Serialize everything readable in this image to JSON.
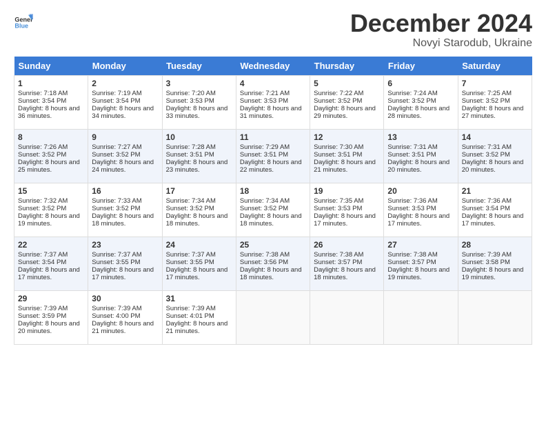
{
  "header": {
    "logo_general": "General",
    "logo_blue": "Blue",
    "month_title": "December 2024",
    "location": "Novyi Starodub, Ukraine"
  },
  "days_of_week": [
    "Sunday",
    "Monday",
    "Tuesday",
    "Wednesday",
    "Thursday",
    "Friday",
    "Saturday"
  ],
  "weeks": [
    [
      {
        "day": "1",
        "sunrise": "Sunrise: 7:18 AM",
        "sunset": "Sunset: 3:54 PM",
        "daylight": "Daylight: 8 hours and 36 minutes."
      },
      {
        "day": "2",
        "sunrise": "Sunrise: 7:19 AM",
        "sunset": "Sunset: 3:54 PM",
        "daylight": "Daylight: 8 hours and 34 minutes."
      },
      {
        "day": "3",
        "sunrise": "Sunrise: 7:20 AM",
        "sunset": "Sunset: 3:53 PM",
        "daylight": "Daylight: 8 hours and 33 minutes."
      },
      {
        "day": "4",
        "sunrise": "Sunrise: 7:21 AM",
        "sunset": "Sunset: 3:53 PM",
        "daylight": "Daylight: 8 hours and 31 minutes."
      },
      {
        "day": "5",
        "sunrise": "Sunrise: 7:22 AM",
        "sunset": "Sunset: 3:52 PM",
        "daylight": "Daylight: 8 hours and 29 minutes."
      },
      {
        "day": "6",
        "sunrise": "Sunrise: 7:24 AM",
        "sunset": "Sunset: 3:52 PM",
        "daylight": "Daylight: 8 hours and 28 minutes."
      },
      {
        "day": "7",
        "sunrise": "Sunrise: 7:25 AM",
        "sunset": "Sunset: 3:52 PM",
        "daylight": "Daylight: 8 hours and 27 minutes."
      }
    ],
    [
      {
        "day": "8",
        "sunrise": "Sunrise: 7:26 AM",
        "sunset": "Sunset: 3:52 PM",
        "daylight": "Daylight: 8 hours and 25 minutes."
      },
      {
        "day": "9",
        "sunrise": "Sunrise: 7:27 AM",
        "sunset": "Sunset: 3:52 PM",
        "daylight": "Daylight: 8 hours and 24 minutes."
      },
      {
        "day": "10",
        "sunrise": "Sunrise: 7:28 AM",
        "sunset": "Sunset: 3:51 PM",
        "daylight": "Daylight: 8 hours and 23 minutes."
      },
      {
        "day": "11",
        "sunrise": "Sunrise: 7:29 AM",
        "sunset": "Sunset: 3:51 PM",
        "daylight": "Daylight: 8 hours and 22 minutes."
      },
      {
        "day": "12",
        "sunrise": "Sunrise: 7:30 AM",
        "sunset": "Sunset: 3:51 PM",
        "daylight": "Daylight: 8 hours and 21 minutes."
      },
      {
        "day": "13",
        "sunrise": "Sunrise: 7:31 AM",
        "sunset": "Sunset: 3:51 PM",
        "daylight": "Daylight: 8 hours and 20 minutes."
      },
      {
        "day": "14",
        "sunrise": "Sunrise: 7:31 AM",
        "sunset": "Sunset: 3:52 PM",
        "daylight": "Daylight: 8 hours and 20 minutes."
      }
    ],
    [
      {
        "day": "15",
        "sunrise": "Sunrise: 7:32 AM",
        "sunset": "Sunset: 3:52 PM",
        "daylight": "Daylight: 8 hours and 19 minutes."
      },
      {
        "day": "16",
        "sunrise": "Sunrise: 7:33 AM",
        "sunset": "Sunset: 3:52 PM",
        "daylight": "Daylight: 8 hours and 18 minutes."
      },
      {
        "day": "17",
        "sunrise": "Sunrise: 7:34 AM",
        "sunset": "Sunset: 3:52 PM",
        "daylight": "Daylight: 8 hours and 18 minutes."
      },
      {
        "day": "18",
        "sunrise": "Sunrise: 7:34 AM",
        "sunset": "Sunset: 3:52 PM",
        "daylight": "Daylight: 8 hours and 18 minutes."
      },
      {
        "day": "19",
        "sunrise": "Sunrise: 7:35 AM",
        "sunset": "Sunset: 3:53 PM",
        "daylight": "Daylight: 8 hours and 17 minutes."
      },
      {
        "day": "20",
        "sunrise": "Sunrise: 7:36 AM",
        "sunset": "Sunset: 3:53 PM",
        "daylight": "Daylight: 8 hours and 17 minutes."
      },
      {
        "day": "21",
        "sunrise": "Sunrise: 7:36 AM",
        "sunset": "Sunset: 3:54 PM",
        "daylight": "Daylight: 8 hours and 17 minutes."
      }
    ],
    [
      {
        "day": "22",
        "sunrise": "Sunrise: 7:37 AM",
        "sunset": "Sunset: 3:54 PM",
        "daylight": "Daylight: 8 hours and 17 minutes."
      },
      {
        "day": "23",
        "sunrise": "Sunrise: 7:37 AM",
        "sunset": "Sunset: 3:55 PM",
        "daylight": "Daylight: 8 hours and 17 minutes."
      },
      {
        "day": "24",
        "sunrise": "Sunrise: 7:37 AM",
        "sunset": "Sunset: 3:55 PM",
        "daylight": "Daylight: 8 hours and 17 minutes."
      },
      {
        "day": "25",
        "sunrise": "Sunrise: 7:38 AM",
        "sunset": "Sunset: 3:56 PM",
        "daylight": "Daylight: 8 hours and 18 minutes."
      },
      {
        "day": "26",
        "sunrise": "Sunrise: 7:38 AM",
        "sunset": "Sunset: 3:57 PM",
        "daylight": "Daylight: 8 hours and 18 minutes."
      },
      {
        "day": "27",
        "sunrise": "Sunrise: 7:38 AM",
        "sunset": "Sunset: 3:57 PM",
        "daylight": "Daylight: 8 hours and 19 minutes."
      },
      {
        "day": "28",
        "sunrise": "Sunrise: 7:39 AM",
        "sunset": "Sunset: 3:58 PM",
        "daylight": "Daylight: 8 hours and 19 minutes."
      }
    ],
    [
      {
        "day": "29",
        "sunrise": "Sunrise: 7:39 AM",
        "sunset": "Sunset: 3:59 PM",
        "daylight": "Daylight: 8 hours and 20 minutes."
      },
      {
        "day": "30",
        "sunrise": "Sunrise: 7:39 AM",
        "sunset": "Sunset: 4:00 PM",
        "daylight": "Daylight: 8 hours and 21 minutes."
      },
      {
        "day": "31",
        "sunrise": "Sunrise: 7:39 AM",
        "sunset": "Sunset: 4:01 PM",
        "daylight": "Daylight: 8 hours and 21 minutes."
      },
      null,
      null,
      null,
      null
    ]
  ]
}
